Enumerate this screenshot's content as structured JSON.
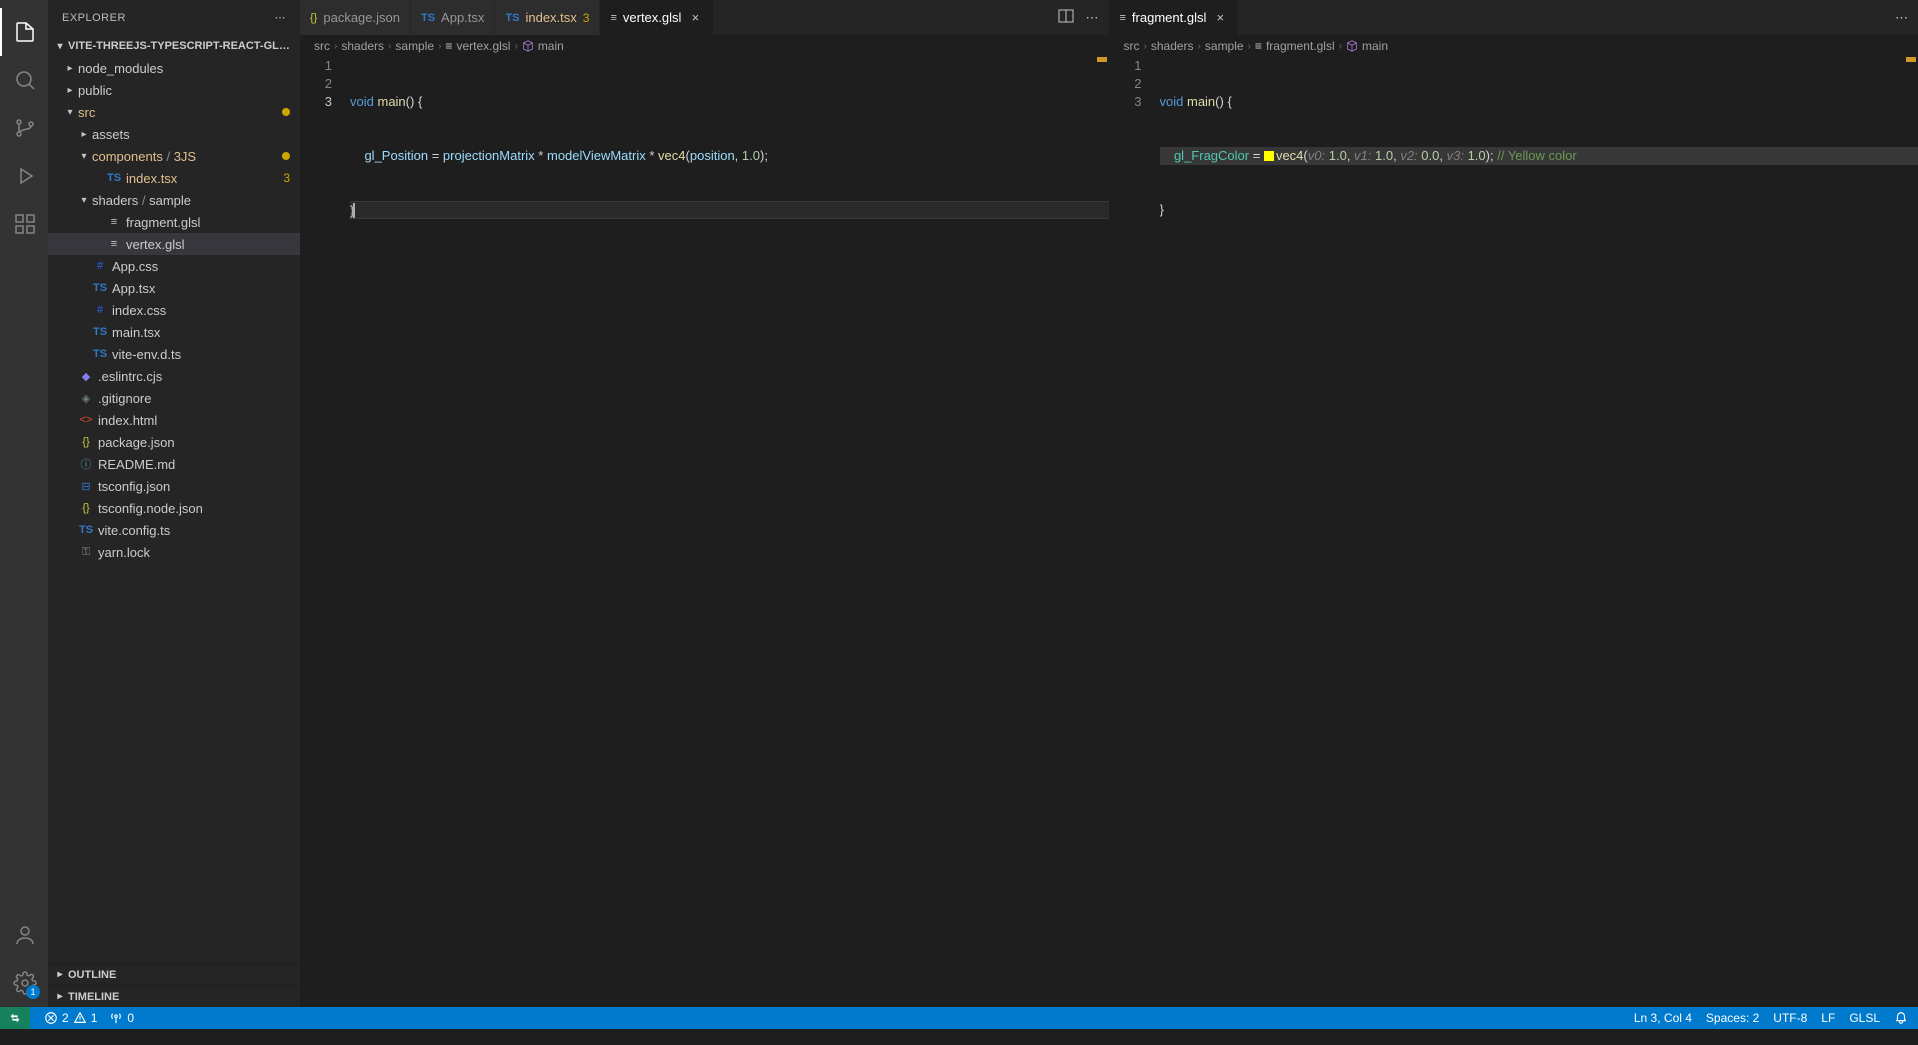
{
  "activity": {
    "manage_badge": "1"
  },
  "sidebar": {
    "title": "EXPLORER",
    "project": "VITE-THREEJS-TYPESCRIPT-REACT-GL…",
    "outline": "OUTLINE",
    "timeline": "TIMELINE",
    "tree": {
      "node_modules": "node_modules",
      "public": "public",
      "src": "src",
      "assets": "assets",
      "components": "components",
      "components_sub": "3JS",
      "index_tsx": "index.tsx",
      "index_tsx_badge": "3",
      "shaders": "shaders",
      "shaders_sub": "sample",
      "fragment_glsl": "fragment.glsl",
      "vertex_glsl": "vertex.glsl",
      "app_css": "App.css",
      "app_tsx": "App.tsx",
      "index_css": "index.css",
      "main_tsx": "main.tsx",
      "vite_env": "vite-env.d.ts",
      "eslint": ".eslintrc.cjs",
      "gitignore": ".gitignore",
      "index_html": "index.html",
      "package_json": "package.json",
      "readme": "README.md",
      "tsconfig": "tsconfig.json",
      "tsconfig_node": "tsconfig.node.json",
      "vite_config": "vite.config.ts",
      "yarn_lock": "yarn.lock"
    }
  },
  "tabs": {
    "left": [
      {
        "label": "package.json",
        "kind": "json"
      },
      {
        "label": "App.tsx",
        "kind": "ts"
      },
      {
        "label": "index.tsx",
        "kind": "ts",
        "badge": "3"
      },
      {
        "label": "vertex.glsl",
        "kind": "glsl",
        "active": true
      }
    ],
    "right": [
      {
        "label": "fragment.glsl",
        "kind": "glsl",
        "active": true
      }
    ]
  },
  "crumbs": {
    "left": [
      "src",
      "shaders",
      "sample",
      "vertex.glsl",
      "main"
    ],
    "right": [
      "src",
      "shaders",
      "sample",
      "fragment.glsl",
      "main"
    ]
  },
  "code": {
    "left": {
      "lines": [
        "1",
        "2",
        "3"
      ],
      "l1_a": "void",
      "l1_b": "main",
      "l1_c": "() {",
      "l2_a": "gl_Position",
      "l2_b": "=",
      "l2_c": "projectionMatrix",
      "l2_d": "*",
      "l2_e": "modelViewMatrix",
      "l2_f": "*",
      "l2_g": "vec4",
      "l2_h": "(",
      "l2_i": "position",
      "l2_j": ", ",
      "l2_k": "1.0",
      "l2_l": ");",
      "l3": "}"
    },
    "right": {
      "lines": [
        "1",
        "2",
        "3"
      ],
      "l1_a": "void",
      "l1_b": "main",
      "l1_c": "() {",
      "l2_a": "gl_FragColor",
      "l2_b": "=",
      "l2_c": "vec4",
      "l2_d": "(",
      "l2_p0": "v0:",
      "l2_v0": "1.0",
      "l2_s0": ", ",
      "l2_p1": "v1:",
      "l2_v1": "1.0",
      "l2_s1": ", ",
      "l2_p2": "v2:",
      "l2_v2": "0.0",
      "l2_s2": ", ",
      "l2_p3": "v3:",
      "l2_v3": "1.0",
      "l2_e": ");",
      "l2_cm": " // Yellow color",
      "l3": "}"
    }
  },
  "status": {
    "errors": "2",
    "warnings": "1",
    "ports": "0",
    "cursor": "Ln 3, Col 4",
    "spaces": "Spaces: 2",
    "encoding": "UTF-8",
    "eol": "LF",
    "lang": "GLSL"
  }
}
